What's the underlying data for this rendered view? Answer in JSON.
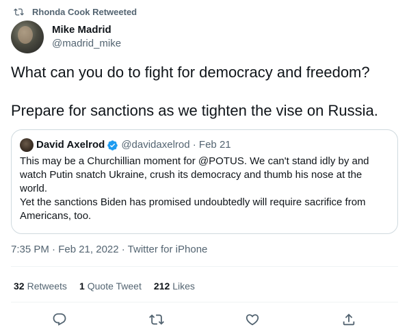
{
  "retweet_banner": {
    "text": "Rhonda Cook Retweeted",
    "icon": "retweet-icon"
  },
  "author": {
    "display_name": "Mike Madrid",
    "handle": "@madrid_mike",
    "avatar": "avatar"
  },
  "tweet": {
    "text": "What can you do to fight for democracy and freedom?\n\nPrepare for sanctions as we tighten the vise on Russia."
  },
  "quote": {
    "display_name": "David Axelrod",
    "verified_icon": "verified-badge-icon",
    "handle_date": "@davidaxelrod · Feb 21",
    "text": "This may be a Churchillian moment for @POTUS.  We can't stand idly by and watch Putin snatch Ukraine, crush its democracy and thumb his nose at the world.\nYet the sanctions Biden has promised undoubtedly will require sacrifice from Americans, too."
  },
  "timestamp": "7:35 PM · Feb 21, 2022 · Twitter for iPhone",
  "stats": {
    "retweets": {
      "count": "32",
      "label": "Retweets"
    },
    "quotes": {
      "count": "1",
      "label": "Quote Tweet"
    },
    "likes": {
      "count": "212",
      "label": "Likes"
    }
  },
  "actions": [
    "reply-icon",
    "retweet-icon",
    "like-icon",
    "share-icon"
  ],
  "colors": {
    "text": "#0f1419",
    "secondary": "#536471",
    "border": "#cfd9de",
    "verified": "#1d9bf0"
  }
}
